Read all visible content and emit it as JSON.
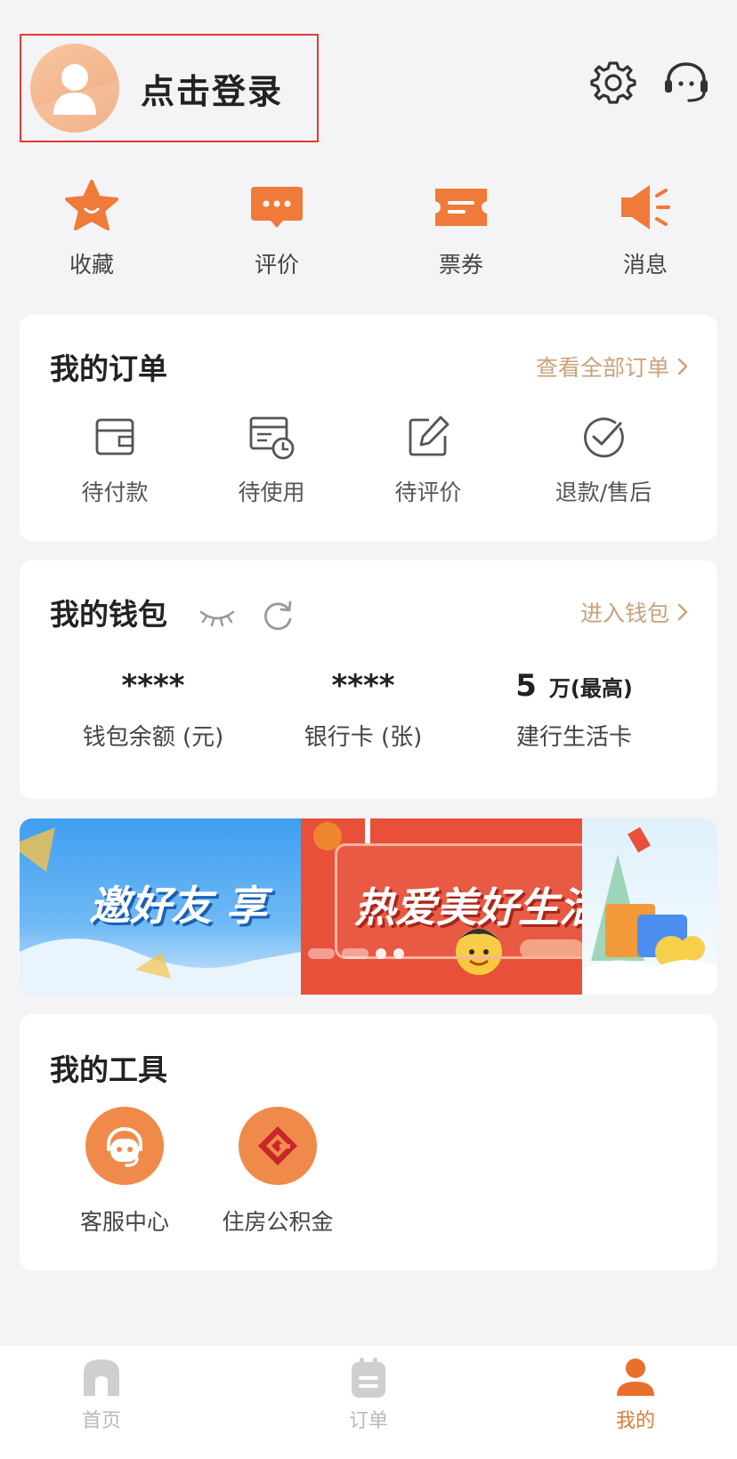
{
  "header": {
    "login_text": "点击登录",
    "settings_icon": "gear-icon",
    "service_icon": "headset-icon"
  },
  "quick_actions": [
    {
      "label": "收藏",
      "icon": "star-icon"
    },
    {
      "label": "评价",
      "icon": "chat-bubble-icon"
    },
    {
      "label": "票券",
      "icon": "ticket-icon"
    },
    {
      "label": "消息",
      "icon": "megaphone-icon"
    }
  ],
  "orders": {
    "title": "我的订单",
    "link": "查看全部订单",
    "items": [
      {
        "label": "待付款",
        "icon": "wallet-icon"
      },
      {
        "label": "待使用",
        "icon": "calendar-clock-icon"
      },
      {
        "label": "待评价",
        "icon": "edit-icon"
      },
      {
        "label": "退款/售后",
        "icon": "check-circle-icon"
      }
    ]
  },
  "wallet": {
    "title": "我的钱包",
    "link": "进入钱包",
    "columns": [
      {
        "value": "****",
        "unit": "",
        "label": "钱包余额 (元)"
      },
      {
        "value": "****",
        "unit": "",
        "label": "银行卡 (张)"
      },
      {
        "value": "5",
        "unit": "万(最高)",
        "label": "建行生活卡"
      }
    ]
  },
  "banner": {
    "slides": [
      "邀好友 享",
      "热爱美好生活 献",
      ""
    ],
    "active_index": 1
  },
  "tools": {
    "title": "我的工具",
    "items": [
      {
        "label": "客服中心",
        "icon": "customer-service-icon"
      },
      {
        "label": "住房公积金",
        "icon": "housing-fund-icon"
      }
    ]
  },
  "tabbar": [
    {
      "label": "首页",
      "icon": "home-icon",
      "active": false
    },
    {
      "label": "订单",
      "icon": "order-icon",
      "active": false
    },
    {
      "label": "我的",
      "icon": "profile-icon",
      "active": true
    }
  ],
  "colors": {
    "accent": "#F07A3A",
    "link": "#C9A27C",
    "highlight_border": "#E53935",
    "background": "#F4F4F6"
  }
}
